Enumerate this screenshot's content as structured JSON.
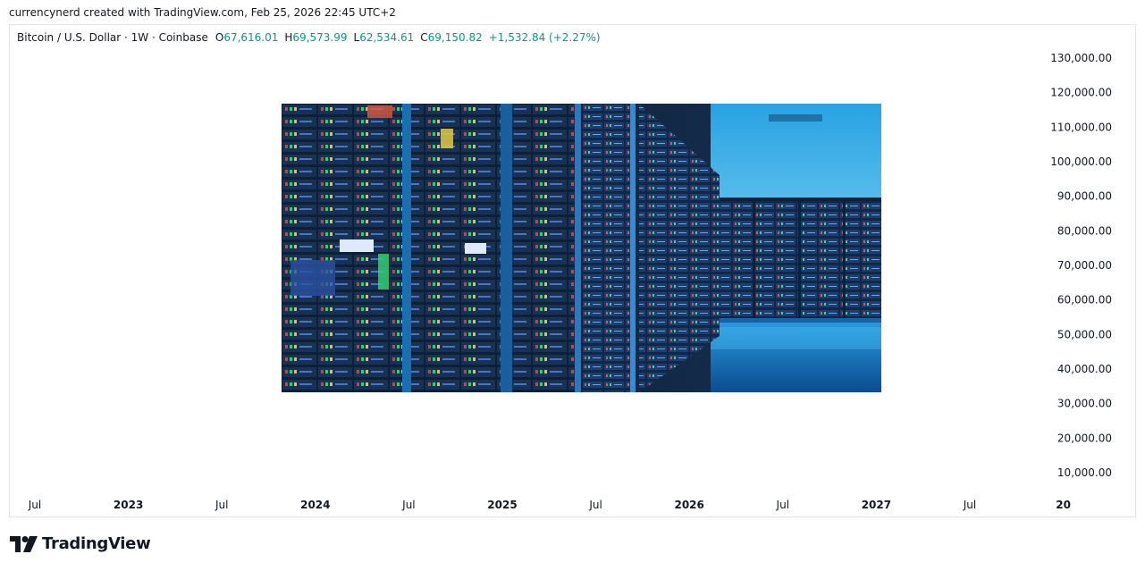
{
  "attribution": "currencynerd created with TradingView.com, Feb 25, 2026 22:45 UTC+2",
  "legend": {
    "symbol": "Bitcoin / U.S. Dollar · 1W · Coinbase",
    "open_label": "O",
    "open": "67,616.01",
    "high_label": "H",
    "high": "69,573.99",
    "low_label": "L",
    "low": "62,534.61",
    "close_label": "C",
    "close": "69,150.82",
    "change": "+1,532.84 (+2.27%)"
  },
  "colors": {
    "up": "#089981",
    "text": "#131722",
    "border": "#e0e3eb"
  },
  "chart_data": {
    "type": "line",
    "title": "Bitcoin / U.S. Dollar · 1W · Coinbase",
    "series": [],
    "y_ticks": [
      "130,000.00",
      "120,000.00",
      "110,000.00",
      "100,000.00",
      "90,000.00",
      "80,000.00",
      "70,000.00",
      "60,000.00",
      "50,000.00",
      "40,000.00",
      "30,000.00",
      "20,000.00",
      "10,000.00"
    ],
    "ylim": [
      10000,
      130000
    ],
    "x_ticks": [
      "Jul",
      "2023",
      "Jul",
      "2024",
      "Jul",
      "2025",
      "Jul",
      "2026",
      "Jul",
      "2027",
      "Jul",
      "20"
    ],
    "grid": false,
    "overlay_image": "server-room-photo"
  },
  "footer": {
    "brand": "TradingView",
    "logo_icon": "tradingview-logo-icon"
  }
}
